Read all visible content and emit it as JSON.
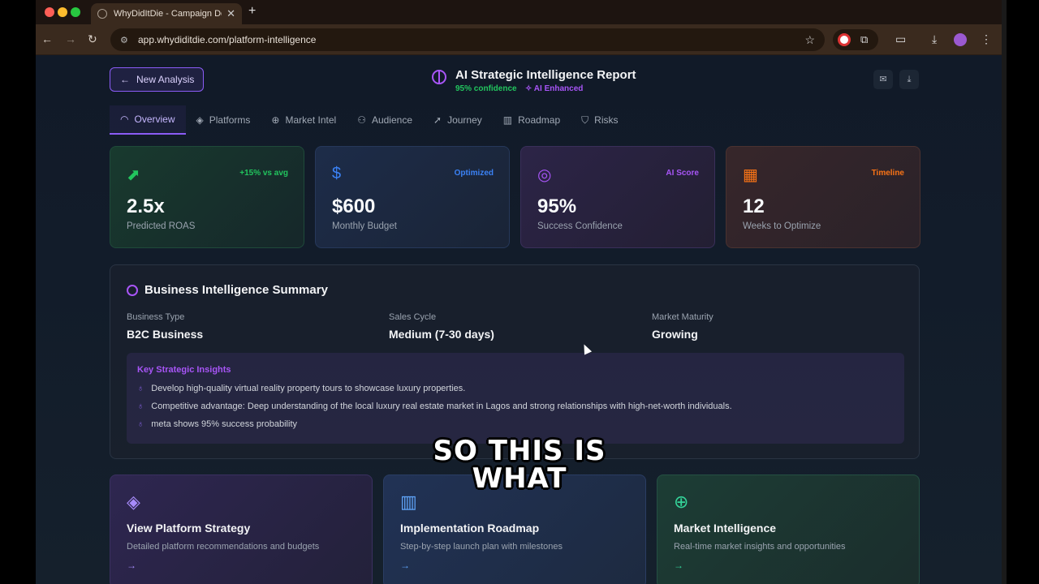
{
  "browser": {
    "tab_title": "WhyDidItDie - Campaign Det",
    "url": "app.whydiditdie.com/platform-intelligence"
  },
  "header": {
    "back_button": "New Analysis",
    "title": "AI Strategic Intelligence Report",
    "confidence": "95% confidence",
    "ai_badge": "AI Enhanced"
  },
  "tabs": [
    {
      "label": "Overview",
      "icon": "gauge-icon"
    },
    {
      "label": "Platforms",
      "icon": "layers-icon"
    },
    {
      "label": "Market Intel",
      "icon": "globe-icon"
    },
    {
      "label": "Audience",
      "icon": "users-icon"
    },
    {
      "label": "Journey",
      "icon": "send-icon"
    },
    {
      "label": "Roadmap",
      "icon": "map-icon"
    },
    {
      "label": "Risks",
      "icon": "shield-icon"
    }
  ],
  "stats": [
    {
      "value": "2.5x",
      "label": "Predicted ROAS",
      "badge": "+15% vs avg",
      "icon": "trending-up-icon",
      "color": "#22c55e"
    },
    {
      "value": "$600",
      "label": "Monthly Budget",
      "badge": "Optimized",
      "icon": "dollar-icon",
      "color": "#3b82f6"
    },
    {
      "value": "95%",
      "label": "Success Confidence",
      "badge": "AI Score",
      "icon": "target-icon",
      "color": "#a855f7"
    },
    {
      "value": "12",
      "label": "Weeks to Optimize",
      "badge": "Timeline",
      "icon": "calendar-icon",
      "color": "#f97316"
    }
  ],
  "summary": {
    "title": "Business Intelligence Summary",
    "fields": [
      {
        "label": "Business Type",
        "value": "B2C Business"
      },
      {
        "label": "Sales Cycle",
        "value": "Medium (7-30 days)"
      },
      {
        "label": "Market Maturity",
        "value": "Growing"
      }
    ],
    "insights_title": "Key Strategic Insights",
    "insights": [
      "Develop high-quality virtual reality property tours to showcase luxury properties.",
      "Competitive advantage: Deep understanding of the local luxury real estate market in Lagos and strong relationships with high-net-worth individuals.",
      "meta shows 95% success probability"
    ]
  },
  "cards": [
    {
      "title": "View Platform Strategy",
      "desc": "Detailed platform recommendations and budgets",
      "icon": "layers-icon",
      "color": "#a78bfa"
    },
    {
      "title": "Implementation Roadmap",
      "desc": "Step-by-step launch plan with milestones",
      "icon": "map-icon",
      "color": "#60a5fa"
    },
    {
      "title": "Market Intelligence",
      "desc": "Real-time market insights and opportunities",
      "icon": "globe-icon",
      "color": "#34d399"
    }
  ],
  "caption": {
    "line1": "SO THIS IS",
    "line2": "WHAT"
  }
}
